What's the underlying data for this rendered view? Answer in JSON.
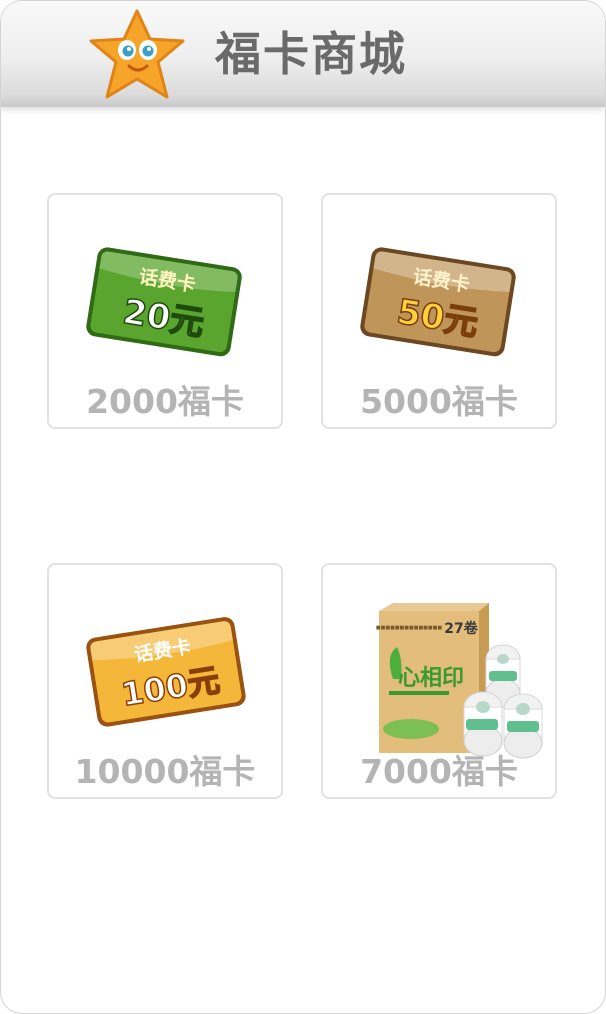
{
  "header": {
    "title": "福卡商城",
    "icon": "star-mascot-icon"
  },
  "items": [
    {
      "card_title": "话费卡",
      "card_amount": "20元",
      "price": "2000福卡",
      "icon": "phone-card-20-icon",
      "colors": {
        "main": "#5aa52e",
        "dark": "#2f6a14"
      }
    },
    {
      "card_title": "话费卡",
      "card_amount": "50元",
      "price": "5000福卡",
      "icon": "phone-card-50-icon",
      "colors": {
        "main": "#c0955a",
        "dark": "#6b4722"
      }
    },
    {
      "card_title": "话费卡",
      "card_amount": "100元",
      "price": "10000福卡",
      "icon": "phone-card-100-icon",
      "colors": {
        "main": "#f5b73a",
        "dark": "#9a5210"
      }
    },
    {
      "box_label": "27卷",
      "brand": "心相印",
      "price": "7000福卡",
      "icon": "tissue-box-icon"
    }
  ]
}
